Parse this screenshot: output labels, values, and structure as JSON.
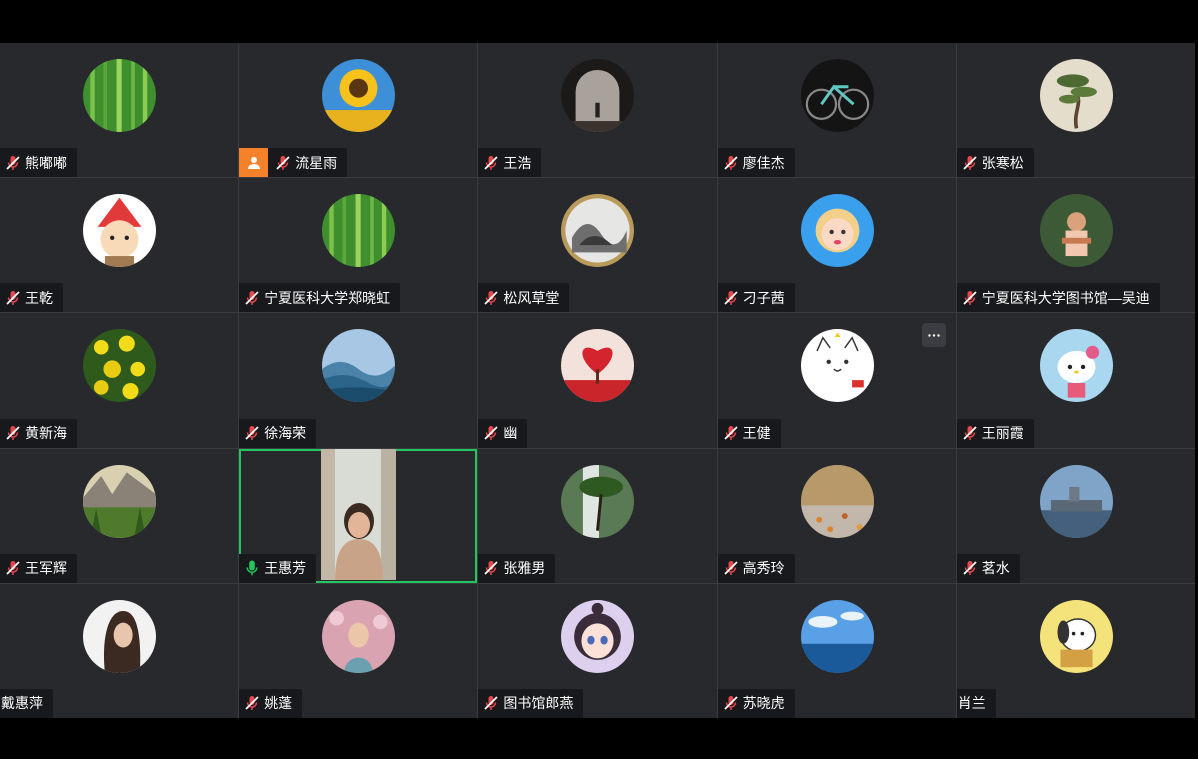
{
  "participants": [
    {
      "name": "熊嘟嘟",
      "mic": "muted",
      "avatar": "bamboo-forest-avatar"
    },
    {
      "name": "流星雨",
      "mic": "muted",
      "avatar": "sunflower-avatar",
      "cohost_icon": "person-icon"
    },
    {
      "name": "王浩",
      "mic": "muted",
      "avatar": "arch-window-avatar"
    },
    {
      "name": "廖佳杰",
      "mic": "muted",
      "avatar": "bicycle-avatar"
    },
    {
      "name": "张寒松",
      "mic": "muted",
      "avatar": "bonsai-pine-avatar"
    },
    {
      "name": "王乾",
      "mic": "muted",
      "avatar": "cartoon-red-hat-avatar"
    },
    {
      "name": "宁夏医科大学郑晓虹",
      "mic": "muted",
      "avatar": "bamboo-forest-avatar"
    },
    {
      "name": "松风草堂",
      "mic": "muted",
      "avatar": "ink-landscape-avatar"
    },
    {
      "name": "刁子茜",
      "mic": "muted",
      "avatar": "cartoon-girl-avatar"
    },
    {
      "name": "宁夏医科大学图书馆—吴迪",
      "mic": "muted",
      "avatar": "child-photo-avatar"
    },
    {
      "name": "黄新海",
      "mic": "muted",
      "avatar": "yellow-flowers-avatar"
    },
    {
      "name": "徐海荣",
      "mic": "muted",
      "avatar": "mountain-mist-avatar"
    },
    {
      "name": "幽",
      "mic": "muted",
      "avatar": "heart-tree-avatar"
    },
    {
      "name": "王健",
      "mic": "muted",
      "avatar": "cartoon-cat-avatar",
      "has_more_button": true
    },
    {
      "name": "王丽霞",
      "mic": "muted",
      "avatar": "hello-kitty-avatar"
    },
    {
      "name": "王军辉",
      "mic": "muted",
      "avatar": "yosemite-valley-avatar"
    },
    {
      "name": "王惠芳",
      "mic": "active",
      "avatar": "video-feed",
      "speaking": true
    },
    {
      "name": "张雅男",
      "mic": "muted",
      "avatar": "waterfall-tree-avatar"
    },
    {
      "name": "高秀玲",
      "mic": "muted",
      "avatar": "autumn-leaves-avatar"
    },
    {
      "name": "茗水",
      "mic": "muted",
      "avatar": "harbor-ship-avatar"
    },
    {
      "name": "戴惠萍",
      "mic": "none",
      "avatar": "woman-portrait-avatar"
    },
    {
      "name": "姚蓬",
      "mic": "muted",
      "avatar": "woman-flowers-avatar"
    },
    {
      "name": "图书馆郎燕",
      "mic": "muted",
      "avatar": "anime-girl-avatar"
    },
    {
      "name": "苏晓虎",
      "mic": "muted",
      "avatar": "sea-sky-avatar"
    },
    {
      "name": "肖兰",
      "mic": "none",
      "avatar": "pochacco-avatar"
    }
  ],
  "colors": {
    "tile_bg": "#27292d",
    "grid_line": "#3a3c41",
    "nameplate_bg": "#18191c",
    "muted_red": "#e5484d",
    "active_green": "#22c55e",
    "cohost_orange": "#f5822a"
  },
  "icons": {
    "muted": "mic-muted-icon",
    "active": "mic-active-icon",
    "more": "more-options-icon"
  }
}
